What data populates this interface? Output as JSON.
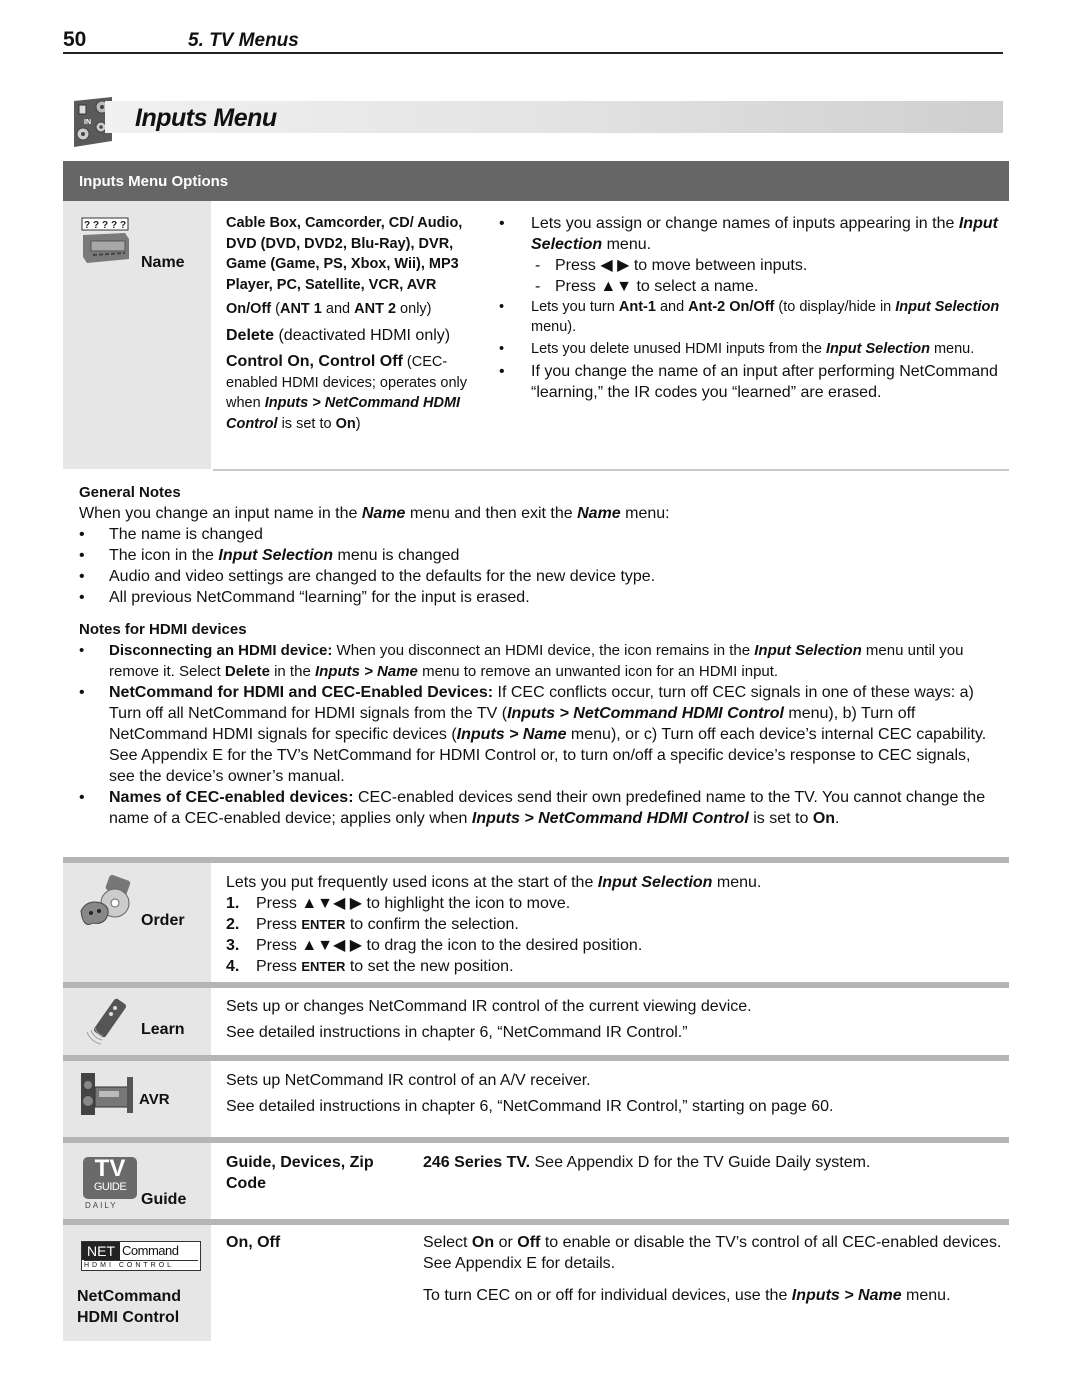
{
  "header": {
    "page_number": "50",
    "chapter": "5.  TV Menus"
  },
  "section": {
    "title": "Inputs Menu",
    "icon": "inputs-panel-icon"
  },
  "options_header": "Inputs Menu Options",
  "name_row": {
    "label": "Name",
    "icon": "name-device-icon",
    "icon_placeholder": "?????",
    "options": {
      "device_list": "Cable Box, Camcorder, CD/ Audio, DVD (DVD, DVD2, Blu-Ray), DVR, Game (Game, PS, Xbox, Wii), MP3 Player, PC, Satellite, VCR, AVR",
      "onoff_bold": "On/Off",
      "onoff_rest_1": " (",
      "onoff_ant1": "ANT 1",
      "onoff_and": " and ",
      "onoff_ant2": "ANT 2",
      "onoff_rest_2": " only)",
      "delete_bold": "Delete",
      "delete_rest": " (deactivated HDMI only)",
      "control_bold": "Control On, Control Off",
      "control_rest_1": " (CEC-enabled HDMI devices; operates only when ",
      "control_path": "Inputs > NetCommand HDMI Control",
      "control_rest_2": " is set to ",
      "control_on": "On",
      "control_rest_3": ")"
    },
    "description": {
      "b1_text": "Lets you assign or change names of inputs appearing in the ",
      "b1_em": "Input Selection",
      "b1_end": " menu.",
      "sub1_pre": "Press ",
      "sub1_keys": "◀ ▶",
      "sub1_post": " to move between inputs.",
      "sub2_pre": "Press ",
      "sub2_keys": "▲▼",
      "sub2_post": " to select a name.",
      "b2_pre": "Lets you turn ",
      "b2_ant1": "Ant-1",
      "b2_and": " and ",
      "b2_ant2": "Ant-2 On/Off",
      "b2_mid": " (to display/hide in ",
      "b2_em": "Input Selection",
      "b2_end": " menu).",
      "b3_pre": "Lets you delete unused HDMI inputs from the ",
      "b3_em": "Input Selection",
      "b3_end": " menu.",
      "b4": "If you change the name of an input after performing NetCommand “learning,” the IR codes you “learned” are erased."
    }
  },
  "general_notes": {
    "heading": "General Notes",
    "intro_1": "When you change an input name in the ",
    "intro_em1": "Name",
    "intro_2": " menu and then exit the ",
    "intro_em2": "Name",
    "intro_3": " menu:",
    "items": [
      {
        "pre": "The name is changed",
        "em": "",
        "post": ""
      },
      {
        "pre": "The icon in the ",
        "em": "Input Selection",
        "post": " menu is changed"
      },
      {
        "pre": "Audio and video settings are changed to the defaults for the new device type.",
        "em": "",
        "post": ""
      },
      {
        "pre": "All previous NetCommand “learning” for the input is erased.",
        "em": "",
        "post": ""
      }
    ]
  },
  "hdmi_notes": {
    "heading": "Notes for HDMI devices",
    "n1_bold": "Disconnecting an HDMI device:",
    "n1_a": "  When you disconnect an HDMI device, the icon remains in the ",
    "n1_em1": "Input Selection",
    "n1_b": " menu until you remove it.  Select ",
    "n1_bold2": "Delete",
    "n1_c": " in the ",
    "n1_em2": "Inputs > Name",
    "n1_d": " menu to remove an unwanted icon for an HDMI input.",
    "n2_bold": "NetCommand for HDMI and CEC-Enabled Devices:",
    "n2_a": "  If CEC conflicts occur, turn off CEC signals in one of these ways:  a) Turn off all NetCommand for HDMI signals from the TV (",
    "n2_em1": "Inputs > NetCommand HDMI Control",
    "n2_b": " menu), b)  Turn off NetCommand HDMI signals for specific devices (",
    "n2_em2": "Inputs > Name",
    "n2_c": " menu), or c)  Turn off each device’s internal CEC capability.  See Appendix E for the TV’s NetCommand for HDMI Control or, to turn on/off a specific device’s response to CEC signals, see the device’s owner’s manual.",
    "n3_bold": "Names of CEC-enabled devices:",
    "n3_a": "  CEC-enabled devices send their own predefined name to the TV.  You cannot change the name of a CEC-enabled device; applies only when ",
    "n3_em": "Inputs > NetCommand HDMI Control",
    "n3_b": " is set to ",
    "n3_on": "On",
    "n3_c": "."
  },
  "order_row": {
    "label": "Order",
    "icon": "order-devices-icon",
    "intro_pre": "Lets you put frequently used icons at the start of the ",
    "intro_em": "Input Selection",
    "intro_post": " menu.",
    "steps": [
      {
        "num": "1.",
        "pre": "Press ",
        "key": "▲▼◀ ▶",
        "post": " to highlight the icon to move."
      },
      {
        "num": "2.",
        "pre": "Press ",
        "key": "ENTER",
        "post": " to confirm the selection."
      },
      {
        "num": "3.",
        "pre": "Press ",
        "key": "▲▼◀ ▶",
        "post": " to drag the icon to the desired position."
      },
      {
        "num": "4.",
        "pre": "Press ",
        "key": "ENTER",
        "post": " to set the new position."
      }
    ]
  },
  "learn_row": {
    "label": "Learn",
    "icon": "remote-control-icon",
    "line1": "Sets up or changes NetCommand IR control of the current viewing device.",
    "line2": "See detailed instructions in chapter 6, “NetCommand IR Control.”"
  },
  "avr_row": {
    "label": "AVR",
    "icon": "av-receiver-icon",
    "line1": "Sets up NetCommand IR control of an A/V receiver.",
    "line2": "See detailed instructions in chapter 6, “NetCommand IR Control,” starting on page 60."
  },
  "guide_row": {
    "label": "Guide",
    "icon": "tv-guide-daily-icon",
    "logo_tv": "TV",
    "logo_guide": "GUIDE",
    "logo_daily": "DAILY",
    "options": "Guide, Devices, Zip Code",
    "desc_bold": "246 Series TV.",
    "desc_rest": "  See Appendix D for the TV Guide Daily system."
  },
  "netcommand_row": {
    "label_line1": "NetCommand",
    "label_line2": "HDMI Control",
    "icon": "netcommand-hdmi-logo",
    "logo_net": "NET",
    "logo_command": "Command",
    "logo_hdmi": "HDMI CONTROL",
    "options": "On, Off",
    "p1_pre": "Select ",
    "p1_on": "On",
    "p1_or": " or ",
    "p1_off": "Off",
    "p1_post": " to enable or disable the TV’s control of all CEC-enabled devices.  See Appendix E for details.",
    "p2_pre": "To turn CEC on or off for individual devices, use the ",
    "p2_em": "Inputs > Name",
    "p2_post": " menu."
  },
  "colors": {
    "header_bar": "#666666",
    "left_cell": "#e6e6e6",
    "divider": "#b5b5b5"
  }
}
